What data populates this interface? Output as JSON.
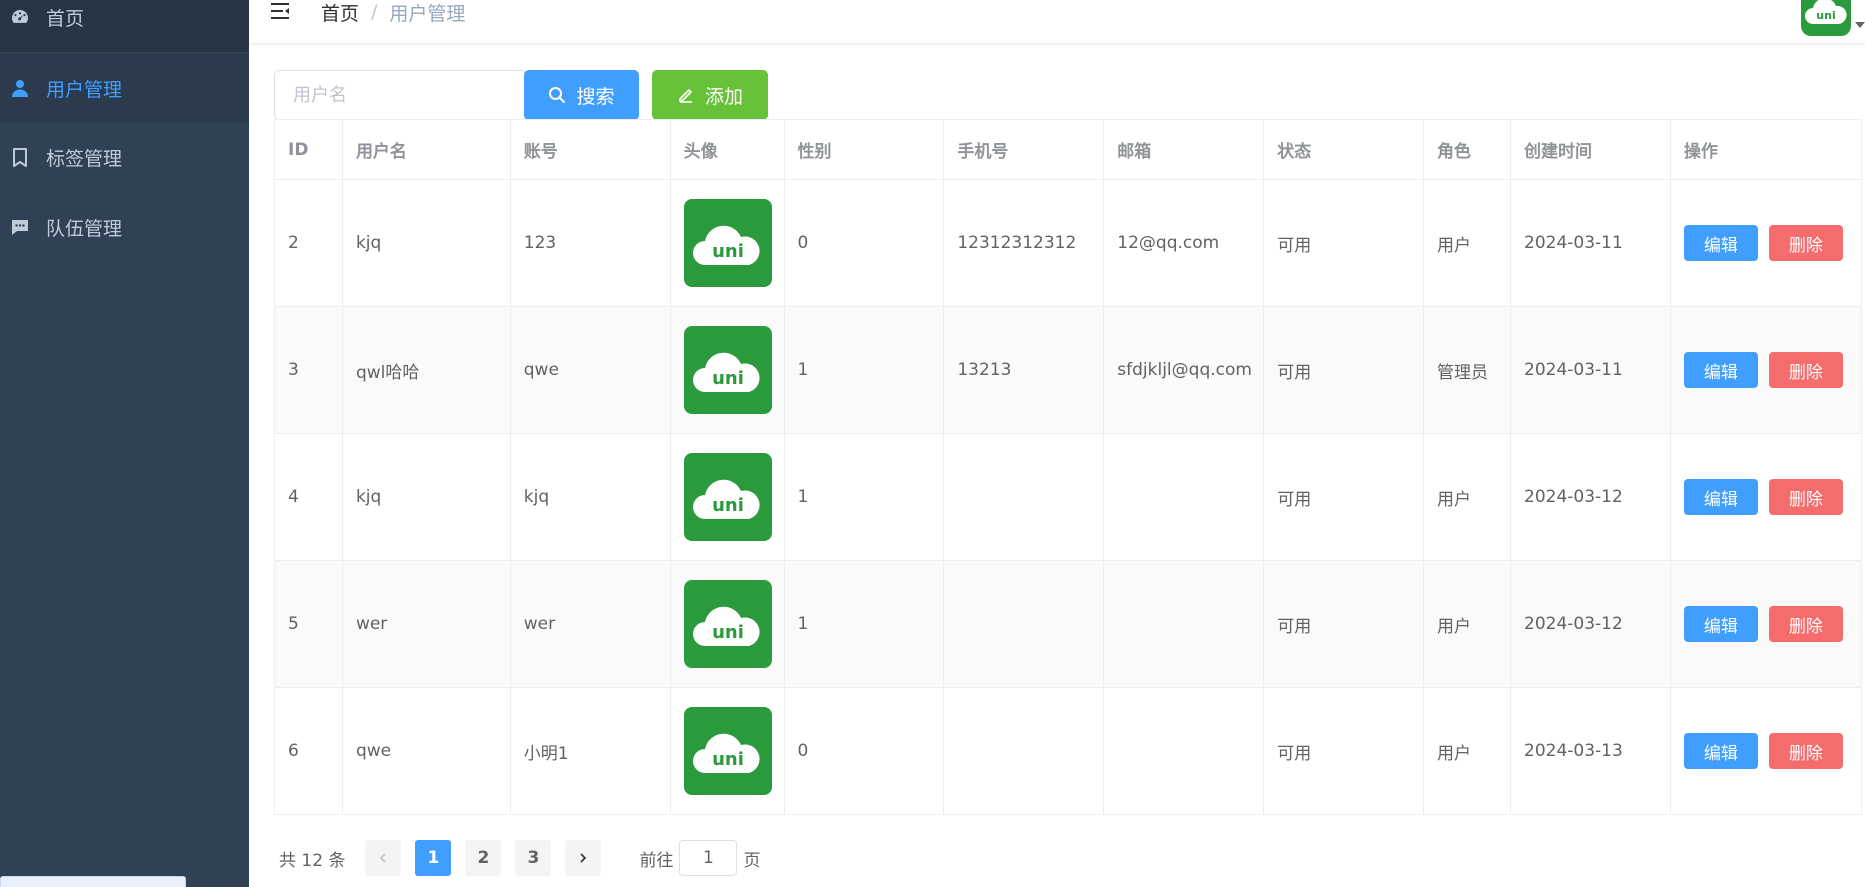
{
  "sidebar": {
    "items": [
      {
        "label": "首页",
        "icon": "dashboard-icon"
      },
      {
        "label": "用户管理",
        "icon": "user-icon",
        "active": true
      },
      {
        "label": "标签管理",
        "icon": "bookmark-icon"
      },
      {
        "label": "队伍管理",
        "icon": "chat-icon"
      }
    ]
  },
  "navbar": {
    "breadcrumb_home": "首页",
    "breadcrumb_sep": "/",
    "breadcrumb_current": "用户管理",
    "avatar_text": "uni"
  },
  "toolbar": {
    "search_placeholder": "用户名",
    "search_label": "搜索",
    "add_label": "添加"
  },
  "table": {
    "headers": [
      "ID",
      "用户名",
      "账号",
      "头像",
      "性别",
      "手机号",
      "邮箱",
      "状态",
      "角色",
      "创建时间",
      "操作"
    ],
    "edit_label": "编辑",
    "delete_label": "删除",
    "avatar_text": "uni",
    "rows": [
      {
        "id": "2",
        "username": "kjq",
        "account": "123",
        "gender": "0",
        "phone": "12312312312",
        "email": "12@qq.com",
        "status": "可用",
        "role": "用户",
        "created": "2024-03-11"
      },
      {
        "id": "3",
        "username": "qwl哈哈",
        "account": "qwe",
        "gender": "1",
        "phone": "13213",
        "email": "sfdjkljl@qq.com",
        "status": "可用",
        "role": "管理员",
        "created": "2024-03-11"
      },
      {
        "id": "4",
        "username": "kjq",
        "account": "kjq",
        "gender": "1",
        "phone": "",
        "email": "",
        "status": "可用",
        "role": "用户",
        "created": "2024-03-12"
      },
      {
        "id": "5",
        "username": "wer",
        "account": "wer",
        "gender": "1",
        "phone": "",
        "email": "",
        "status": "可用",
        "role": "用户",
        "created": "2024-03-12"
      },
      {
        "id": "6",
        "username": "qwe",
        "account": "小明1",
        "gender": "0",
        "phone": "",
        "email": "",
        "status": "可用",
        "role": "用户",
        "created": "2024-03-13"
      }
    ]
  },
  "pagination": {
    "total": "共 12 条",
    "pages": [
      "1",
      "2",
      "3"
    ],
    "current": "1",
    "goto_prefix": "前往",
    "goto_value": "1",
    "goto_suffix": "页"
  },
  "colors": {
    "sidebar_bg": "#304156",
    "primary": "#409eff",
    "success": "#67c23a",
    "danger": "#f56c6c",
    "logo_green": "#2a9a3c"
  }
}
